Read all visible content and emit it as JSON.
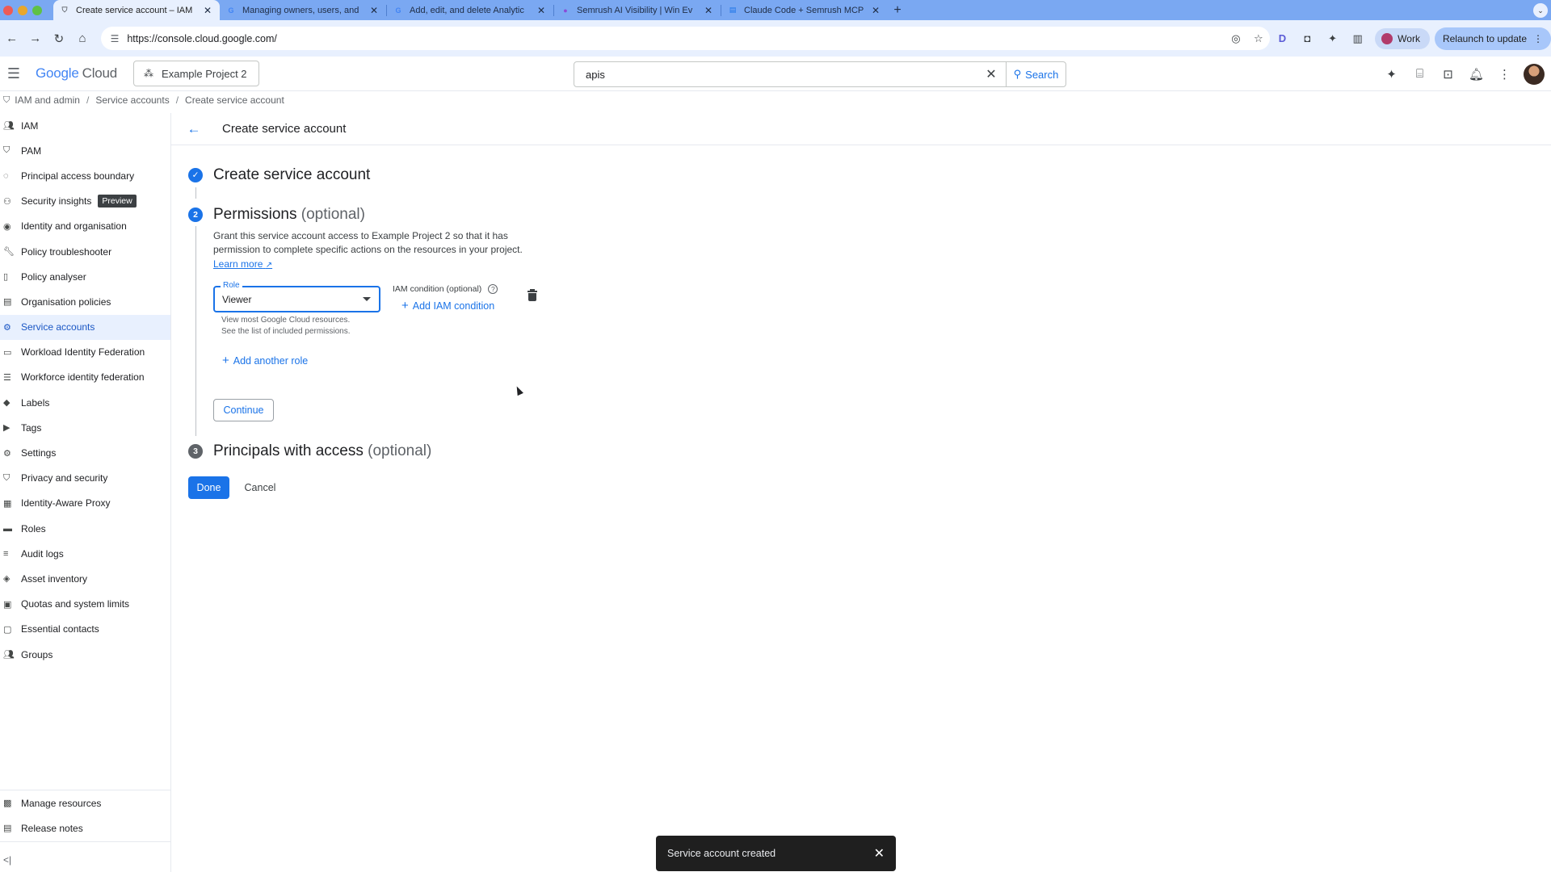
{
  "browser": {
    "tabs": [
      {
        "label": "Create service account – IAM",
        "favicon": "shield-icon",
        "active": true
      },
      {
        "label": "Managing owners, users, and",
        "favicon": "google-icon",
        "active": false
      },
      {
        "label": "Add, edit, and delete Analytic",
        "favicon": "google-icon",
        "active": false
      },
      {
        "label": "Semrush AI Visibility | Win Ev",
        "favicon": "semrush-icon",
        "active": false
      },
      {
        "label": "Claude Code + Semrush MCP",
        "favicon": "docs-icon",
        "active": false
      }
    ],
    "url": "https://console.cloud.google.com/",
    "profile_label": "Work",
    "relaunch_label": "Relaunch to update"
  },
  "header": {
    "brand_google": "Google",
    "brand_cloud": "Cloud",
    "project": "Example Project 2",
    "search_value": "apis",
    "search_button": "Search"
  },
  "breadcrumb": [
    "IAM and admin",
    "Service accounts",
    "Create service account"
  ],
  "sidebar": {
    "items": [
      {
        "label": "IAM",
        "icon": "person-add-icon"
      },
      {
        "label": "PAM",
        "icon": "shield-icon"
      },
      {
        "label": "Principal access boundary",
        "icon": "boundary-icon"
      },
      {
        "label": "Security insights",
        "icon": "insights-icon",
        "badge": "Preview"
      },
      {
        "label": "Identity and organisation",
        "icon": "account-circle-icon"
      },
      {
        "label": "Policy troubleshooter",
        "icon": "wrench-icon"
      },
      {
        "label": "Policy analyser",
        "icon": "document-search-icon"
      },
      {
        "label": "Organisation policies",
        "icon": "policy-doc-icon"
      },
      {
        "label": "Service accounts",
        "icon": "service-account-icon",
        "selected": true
      },
      {
        "label": "Workload Identity Federation",
        "icon": "workload-icon"
      },
      {
        "label": "Workforce identity federation",
        "icon": "list-icon"
      },
      {
        "label": "Labels",
        "icon": "label-icon"
      },
      {
        "label": "Tags",
        "icon": "tag-icon"
      },
      {
        "label": "Settings",
        "icon": "gear-icon"
      },
      {
        "label": "Privacy and security",
        "icon": "privacy-shield-icon"
      },
      {
        "label": "Identity-Aware Proxy",
        "icon": "proxy-icon"
      },
      {
        "label": "Roles",
        "icon": "roles-icon"
      },
      {
        "label": "Audit logs",
        "icon": "audit-list-icon"
      },
      {
        "label": "Asset inventory",
        "icon": "diamond-icon"
      },
      {
        "label": "Quotas and system limits",
        "icon": "quota-icon"
      },
      {
        "label": "Essential contacts",
        "icon": "contacts-icon"
      },
      {
        "label": "Groups",
        "icon": "groups-icon"
      }
    ],
    "bottom": [
      {
        "label": "Manage resources",
        "icon": "folder-gear-icon"
      },
      {
        "label": "Release notes",
        "icon": "notes-icon"
      }
    ],
    "collapse_glyph": "<|"
  },
  "main": {
    "title": "Create service account",
    "steps": [
      {
        "number": "✓",
        "title": "Create service account",
        "optional": "",
        "state": "done"
      },
      {
        "number": "2",
        "title": "Permissions",
        "optional": "(optional)",
        "state": "active"
      },
      {
        "number": "3",
        "title": "Principals with access",
        "optional": "(optional)",
        "state": "idle"
      }
    ],
    "permissions": {
      "description": "Grant this service account access to Example Project 2 so that it has permission to complete specific actions on the resources in your project.",
      "learn_more": "Learn more",
      "role_label": "Role",
      "role_value": "Viewer",
      "role_help_1": "View most Google Cloud resources.",
      "role_help_2": "See the list of included permissions.",
      "condition_label": "IAM condition (optional)",
      "add_condition": "Add IAM condition",
      "add_role": "Add another role",
      "continue": "Continue"
    },
    "done": "Done",
    "cancel": "Cancel"
  },
  "snackbar": {
    "message": "Service account created"
  }
}
